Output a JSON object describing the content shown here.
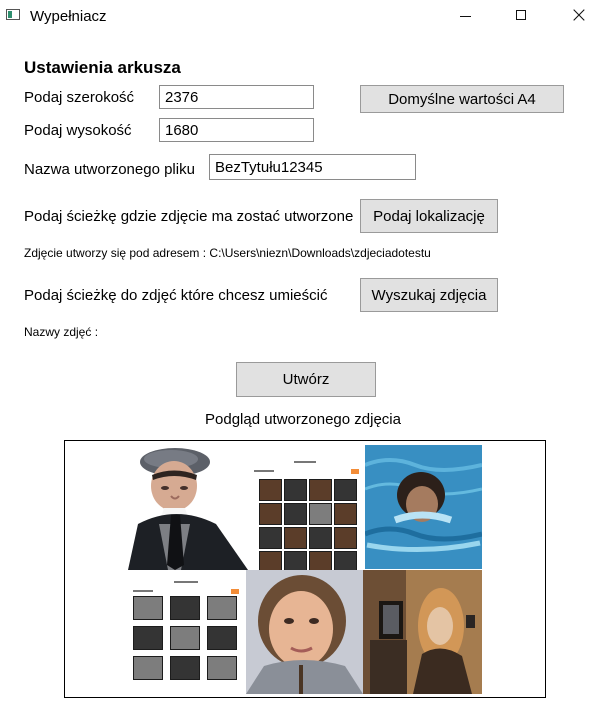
{
  "window": {
    "title": "Wypełniacz",
    "controls": {
      "minimize_icon": "minimize-icon",
      "maximize_icon": "maximize-icon",
      "close_icon": "close-icon",
      "close_glyph": "×"
    }
  },
  "settings": {
    "heading": "Ustawienia arkusza",
    "width_label": "Podaj szerokość",
    "width_value": "2376",
    "height_label": "Podaj wysokość",
    "height_value": "1680",
    "default_button": "Domyślne wartości A4",
    "filename_label": "Nazwa utworzonego pliku",
    "filename_value": "BezTytułu12345"
  },
  "location": {
    "prompt": "Podaj ścieżkę gdzie zdjęcie ma zostać utworzone",
    "button": "Podaj lokalizację",
    "address_text": "Zdjęcie utworzy się pod adresem : C:\\Users\\niezn\\Downloads\\zdjeciadotestu"
  },
  "images": {
    "prompt": "Podaj ścieżkę do zdjęć które chcesz umieścić",
    "button": "Wyszukaj zdjęcia",
    "names_label": "Nazwy zdjęć :"
  },
  "actions": {
    "create_button": "Utwórz"
  },
  "preview": {
    "title": "Podgląd utworzonego zdjęcia",
    "tiles": [
      {
        "name": "preview-man-photo"
      },
      {
        "name": "preview-grid-photo"
      },
      {
        "name": "preview-sea-photo"
      },
      {
        "name": "preview-collage-photo"
      },
      {
        "name": "preview-girl-photo"
      },
      {
        "name": "preview-room-photo"
      }
    ]
  },
  "colors": {
    "button_background": "#e1e1e1",
    "button_border": "#9a9a9a",
    "input_border": "#8a8a8a",
    "preview_border": "#000000",
    "app_icon_accent": "#2f8f6f"
  }
}
